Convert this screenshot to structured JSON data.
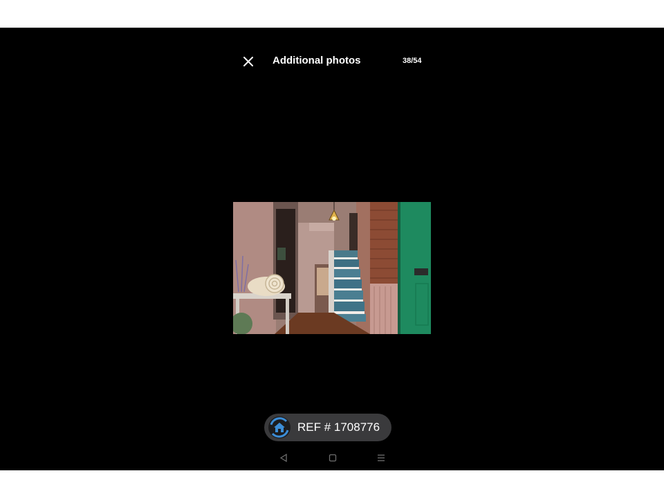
{
  "header": {
    "title": "Additional photos",
    "counter": "38/54",
    "close_icon": "close-icon"
  },
  "photo": {
    "alt": "Hallway with tiled staircase, shell ornament on console table and green front door"
  },
  "reference": {
    "label": "REF # 1708776",
    "icon": "home-refresh-icon",
    "accent": "#3c8dd6"
  },
  "navbar": {
    "back_icon": "back-triangle-icon",
    "home_icon": "home-square-icon",
    "recents_icon": "recents-lines-icon"
  }
}
